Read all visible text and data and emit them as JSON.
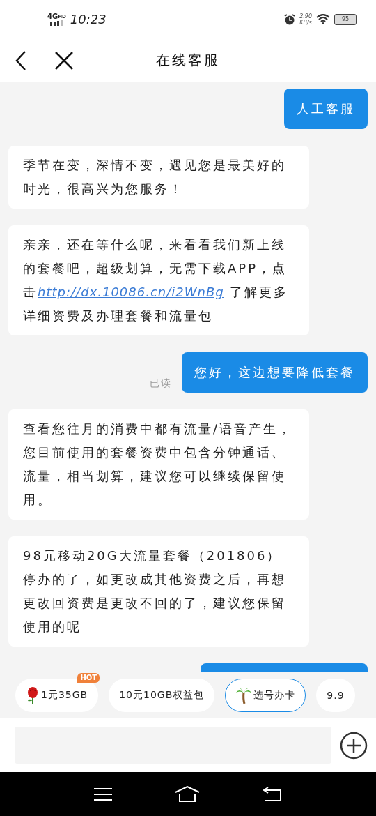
{
  "status_bar": {
    "network": "4G",
    "network_sub": "HD",
    "time": "10:23",
    "speed": "2.90",
    "speed_unit": "KB/s",
    "battery": "95"
  },
  "header": {
    "title": "在线客服"
  },
  "messages": [
    {
      "kind": "user",
      "text": "人工客服"
    },
    {
      "kind": "bot",
      "text": "季节在变，深情不变，遇见您是最美好的时光，很高兴为您服务！"
    },
    {
      "kind": "bot",
      "text": "亲亲，还在等什么呢，来看看我们新上线的套餐吧，超级划算，无需下载APP，点击",
      "link": "http://dx.10086.cn/i2WnBg",
      "after": " 了解更多详细资费及办理套餐和流量包"
    },
    {
      "kind": "user",
      "text": "您好，这边想要降低套餐",
      "receipt": "已读"
    },
    {
      "kind": "bot",
      "text": "查看您往月的消费中都有流量/语音产生，您目前使用的套餐资费中包含分钟通话、流量，相当划算，建议您可以继续保留使用。"
    },
    {
      "kind": "bot",
      "text": "98元移动20G大流量套餐（201806）停办的了，如更改成其他资费之后，再想更改回资费是更改不回的了，建议您保留使用的呢"
    },
    {
      "kind": "user-cut"
    }
  ],
  "quick_replies": [
    {
      "kind": "rose",
      "label": "1元35GB",
      "badge": "HOT",
      "selected": false
    },
    {
      "kind": "plain",
      "label": "10元10GB权益包",
      "selected": false
    },
    {
      "kind": "palm",
      "label": "选号办卡",
      "selected": true
    },
    {
      "kind": "plain",
      "label": "9.9",
      "selected": false
    }
  ]
}
